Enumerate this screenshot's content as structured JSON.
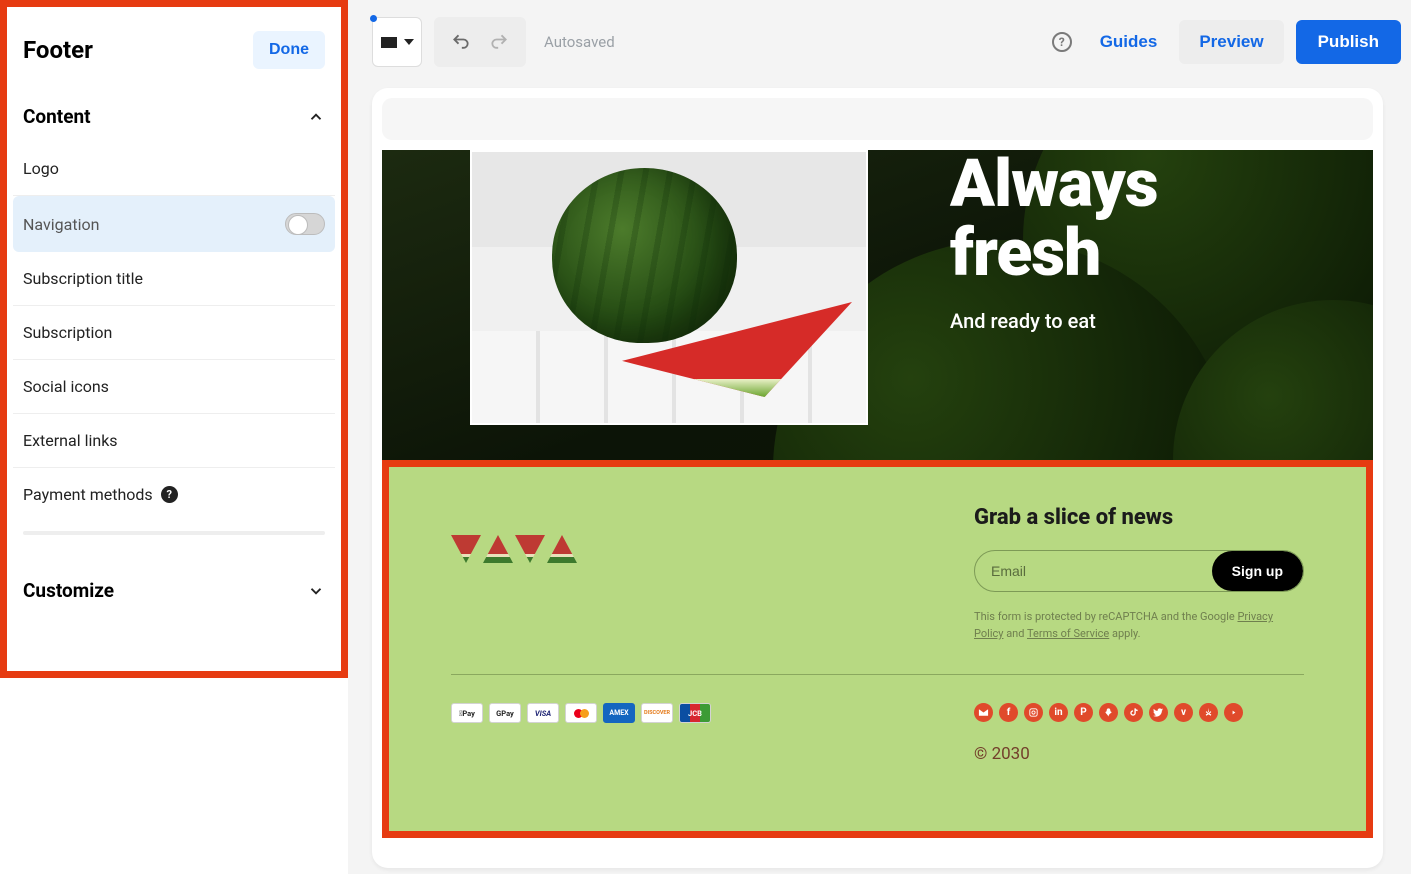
{
  "sidebar": {
    "title": "Footer",
    "done": "Done",
    "content_header": "Content",
    "items": {
      "logo": "Logo",
      "navigation": "Navigation",
      "subscription_title": "Subscription title",
      "subscription": "Subscription",
      "social_icons": "Social icons",
      "external_links": "External links",
      "payment_methods": "Payment methods"
    },
    "customize_header": "Customize"
  },
  "toolbar": {
    "autosaved": "Autosaved",
    "guides": "Guides",
    "preview": "Preview",
    "publish": "Publish"
  },
  "hero": {
    "title_l1": "Always",
    "title_l2": "fresh",
    "subtitle": "And ready to eat"
  },
  "footer": {
    "newsletter_title": "Grab a slice of news",
    "email_placeholder": "Email",
    "signup": "Sign up",
    "legal_pre": "This form is protected by reCAPTCHA and the Google ",
    "legal_privacy": "Privacy Policy",
    "legal_and": " and ",
    "legal_tos": "Terms of Service",
    "legal_post": " apply.",
    "payments": {
      "apple": "Pay",
      "google": "GPay",
      "visa": "VISA",
      "amex": "AMEX",
      "discover": "DISCOVER",
      "jcb": "JCB"
    },
    "copyright": "© 2030"
  }
}
